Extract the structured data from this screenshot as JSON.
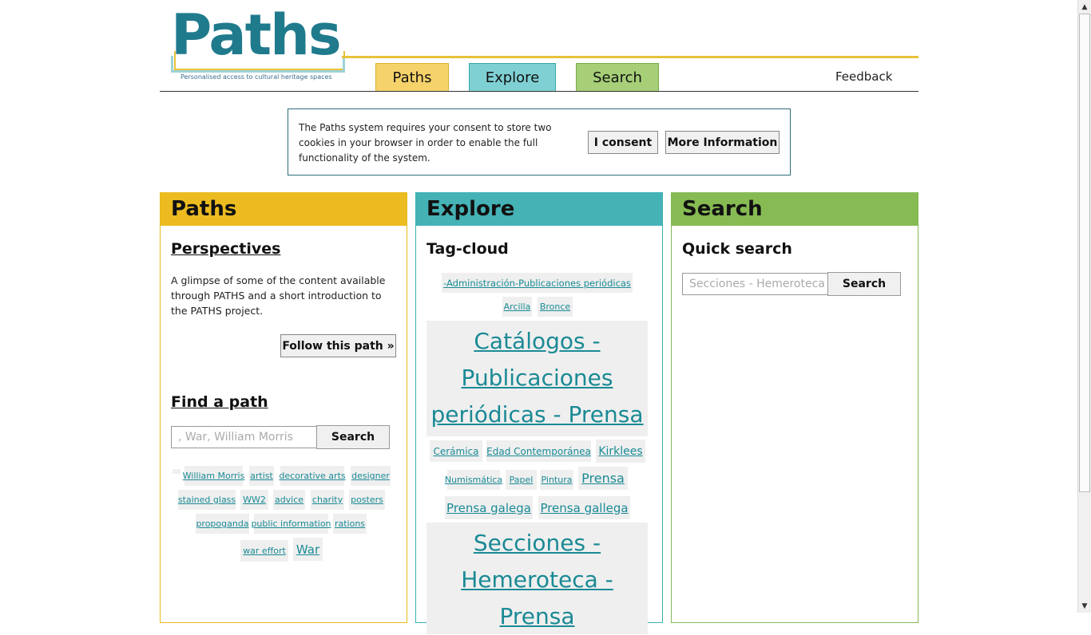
{
  "header": {
    "logo_text": "Paths",
    "logo_tagline": "Personalised access to cultural heritage spaces",
    "nav": {
      "paths": "Paths",
      "explore": "Explore",
      "search": "Search"
    },
    "feedback": "Feedback"
  },
  "cookie": {
    "text": "The Paths system requires your consent to store two cookies in your browser in order to enable the full functionality of the system.",
    "consent_label": "I consent",
    "more_label": "More Information"
  },
  "paths_col": {
    "title": "Paths",
    "perspectives_title": "Perspectives",
    "perspectives_text": "A glimpse of some of the content available through PATHS and a short introduction to the PATHS project.",
    "follow_label": "Follow this path »",
    "find_title": "Find a path",
    "find_placeholder": ", War,      William Morris",
    "find_button": "Search",
    "tags": [
      "William Morris",
      "artist",
      "decorative arts",
      "designer",
      "stained glass",
      "WW2",
      "advice",
      "charity",
      "posters",
      "propoganda",
      "public information",
      "rations",
      "war effort",
      "War"
    ]
  },
  "explore_col": {
    "title": "Explore",
    "tagcloud_title": "Tag-cloud",
    "tags": [
      "-Administración-Publicaciones periódicas",
      "Arcilla",
      "Bronce",
      "Catálogos - Publicaciones periódicas - Prensa",
      "Cerámica",
      "Edad Contemporánea",
      "Kirklees",
      "Numismática",
      "Papel",
      "Pintura",
      "Prensa",
      "Prensa galega",
      "Prensa gallega",
      "Secciones - Hemeroteca - Prensa"
    ]
  },
  "search_col": {
    "title": "Search",
    "quick_title": "Quick search",
    "placeholder": "Secciones - Hemeroteca - Prensa",
    "button": "Search"
  },
  "colors": {
    "paths": "#ecbb20",
    "explore": "#45b2b5",
    "search": "#86ba52",
    "link": "#1a8a95"
  },
  "icons": {
    "scroll_up": "arrow-up-icon",
    "scroll_down": "arrow-down-icon"
  }
}
